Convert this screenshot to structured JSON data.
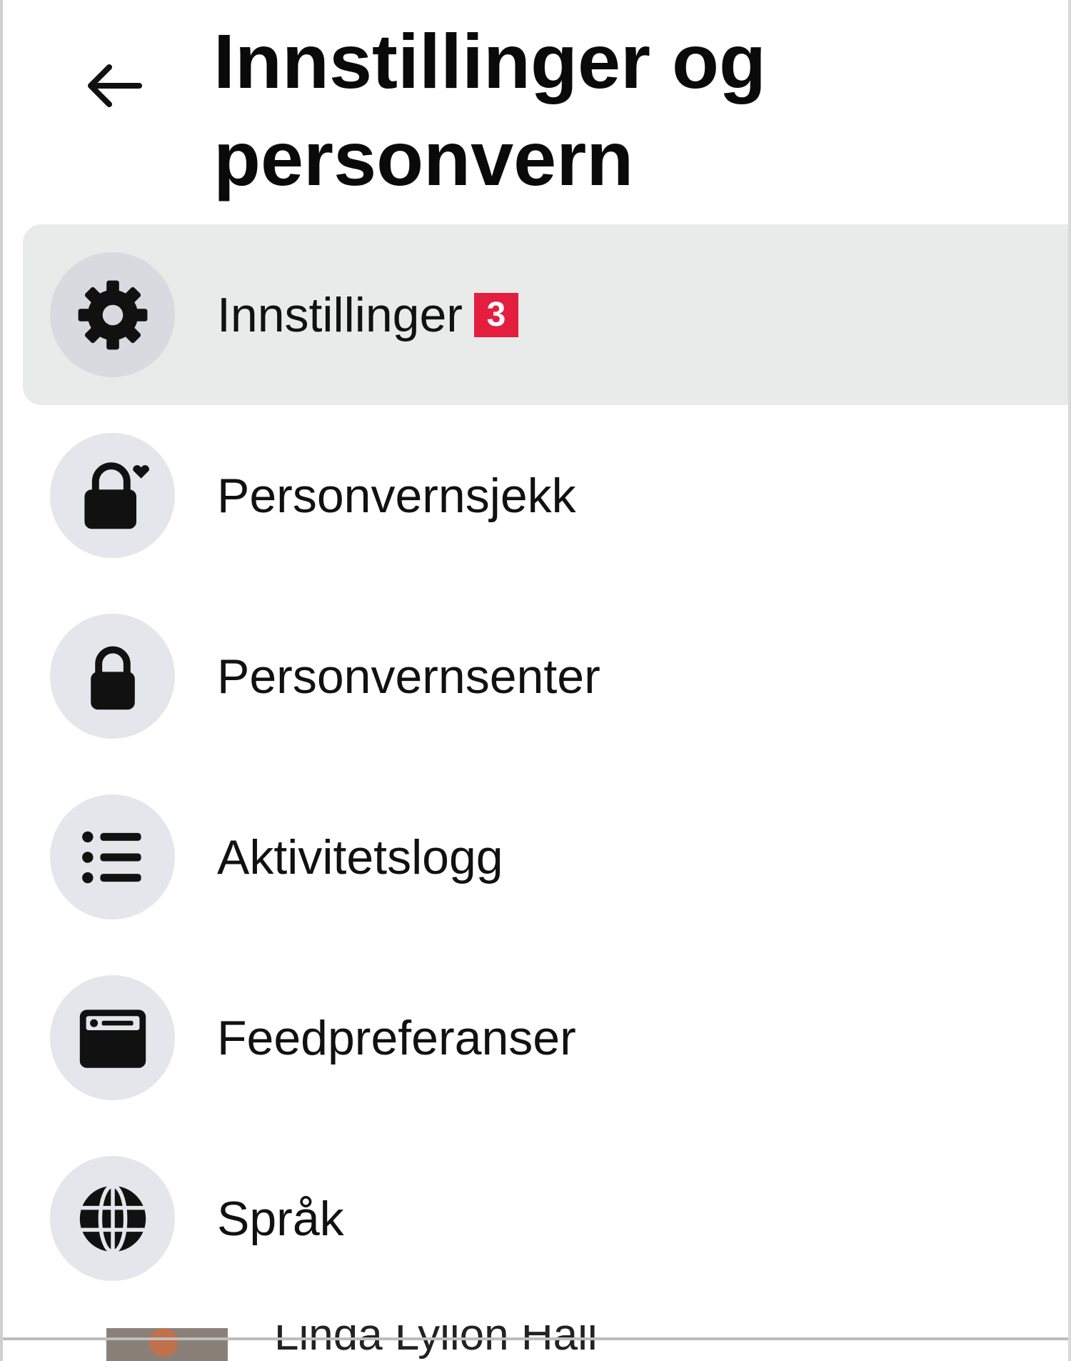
{
  "header": {
    "title": "Innstillinger og personvern",
    "back_icon": "arrow-left-icon"
  },
  "menu": {
    "items": [
      {
        "label": "Innstillinger",
        "icon": "gear-icon",
        "badge": "3",
        "active": true
      },
      {
        "label": "Personvernsjekk",
        "icon": "lock-heart-icon"
      },
      {
        "label": "Personvernsenter",
        "icon": "lock-icon"
      },
      {
        "label": "Aktivitetslogg",
        "icon": "list-icon"
      },
      {
        "label": "Feedpreferanser",
        "icon": "feed-card-icon"
      },
      {
        "label": "Språk",
        "icon": "globe-icon"
      }
    ]
  },
  "below_fold": {
    "name": "Linda Lyllon Hall"
  },
  "colors": {
    "badge": "#e41e3f",
    "active_row": "#e9ebea",
    "icon_circle": "#e4e6eb"
  }
}
